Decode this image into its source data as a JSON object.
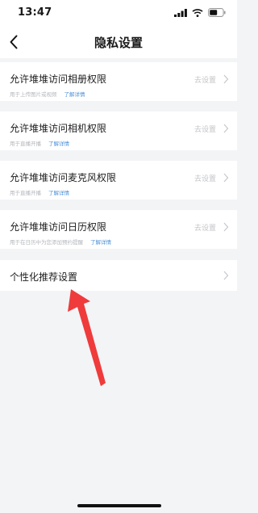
{
  "status_bar": {
    "time": "13:47"
  },
  "header": {
    "title": "隐私设置"
  },
  "permissions": [
    {
      "title": "允许堆堆访问相册权限",
      "desc": "用于上传图片或视频",
      "link": "了解详情",
      "action": "去设置"
    },
    {
      "title": "允许堆堆访问相机权限",
      "desc": "用于直播开播",
      "link": "了解详情",
      "action": "去设置"
    },
    {
      "title": "允许堆堆访问麦克风权限",
      "desc": "用于直播开播",
      "link": "了解详情",
      "action": "去设置"
    },
    {
      "title": "允许堆堆访问日历权限",
      "desc": "用于在日历中为您添加预约提醒",
      "link": "了解详情",
      "action": "去设置"
    }
  ],
  "recommendation": {
    "title": "个性化推荐设置"
  },
  "colors": {
    "accent_link": "#4a8fd8",
    "annotation_arrow": "#ef3b3b",
    "background": "#f3f4f6"
  },
  "icons": [
    "back-chevron-icon",
    "signal-icon",
    "wifi-icon",
    "battery-icon",
    "chevron-right-icon"
  ]
}
